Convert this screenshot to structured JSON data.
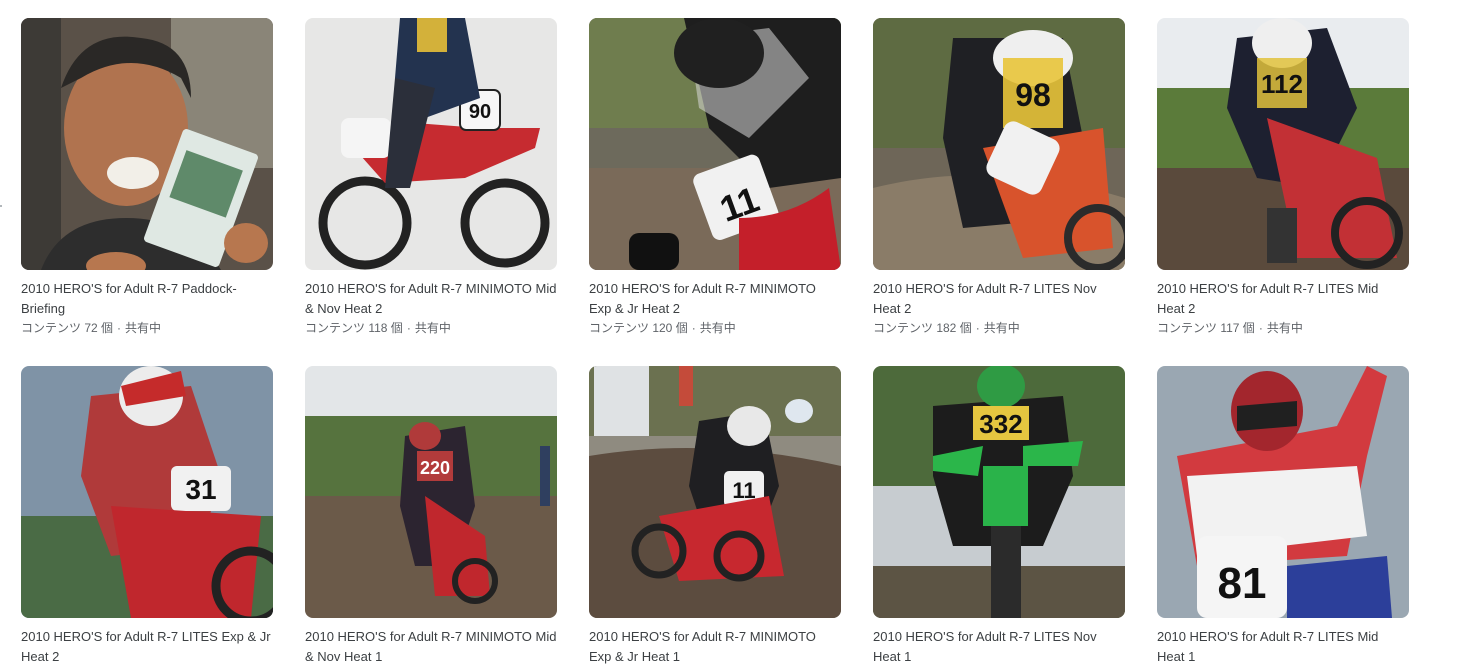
{
  "albums": [
    {
      "title": "2010 HERO'S for Adult R-7 Paddock-Briefing",
      "count_label": "コンテンツ 72 個",
      "shared_label": "共有中",
      "icon": "photo-thumbnail",
      "number": ""
    },
    {
      "title": "2010 HERO'S for Adult R-7 MINIMOTO Mid & Nov Heat 2",
      "count_label": "コンテンツ 118 個",
      "shared_label": "共有中",
      "icon": "photo-thumbnail",
      "number": "90"
    },
    {
      "title": "2010 HERO'S for Adult R-7 MINIMOTO Exp & Jr Heat 2",
      "count_label": "コンテンツ 120 個",
      "shared_label": "共有中",
      "icon": "photo-thumbnail",
      "number": "11"
    },
    {
      "title": "2010 HERO'S for Adult R-7 LITES Nov Heat 2",
      "count_label": "コンテンツ 182 個",
      "shared_label": "共有中",
      "icon": "photo-thumbnail",
      "number": "98"
    },
    {
      "title": "2010 HERO'S for Adult R-7 LITES Mid Heat 2",
      "count_label": "コンテンツ 117 個",
      "shared_label": "共有中",
      "icon": "photo-thumbnail",
      "number": "112"
    },
    {
      "title": "2010 HERO'S for Adult R-7 LITES Exp & Jr Heat 2",
      "count_label": "",
      "shared_label": "",
      "icon": "photo-thumbnail",
      "number": "31"
    },
    {
      "title": "2010 HERO'S for Adult R-7 MINIMOTO Mid & Nov Heat 1",
      "count_label": "",
      "shared_label": "",
      "icon": "photo-thumbnail",
      "number": "220"
    },
    {
      "title": "2010 HERO'S for Adult R-7 MINIMOTO Exp & Jr Heat 1",
      "count_label": "",
      "shared_label": "",
      "icon": "photo-thumbnail",
      "number": "11"
    },
    {
      "title": "2010 HERO'S for Adult R-7 LITES Nov Heat 1",
      "count_label": "",
      "shared_label": "",
      "icon": "photo-thumbnail",
      "number": "332"
    },
    {
      "title": "2010 HERO'S for Adult R-7 LITES Mid Heat 1",
      "count_label": "",
      "shared_label": "",
      "icon": "photo-thumbnail",
      "number": "81"
    }
  ],
  "colors": {
    "title_text": "#3c4043",
    "meta_text": "#5f6368"
  }
}
